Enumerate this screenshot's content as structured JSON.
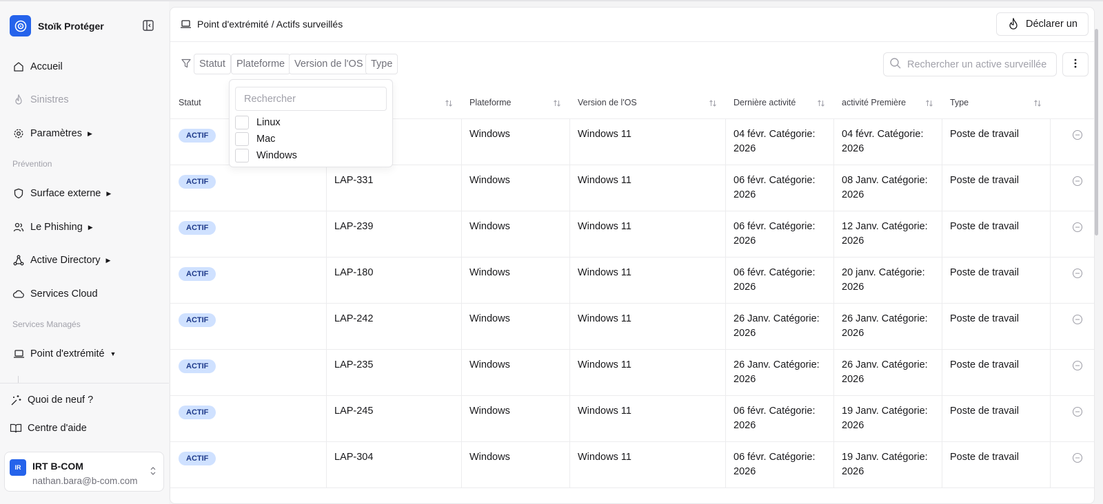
{
  "brand": {
    "name": "Stoïk Protéger"
  },
  "colors": {
    "accent": "#2563eb",
    "badge_bg": "#cfe1ff",
    "badge_text": "#1e3a8a"
  },
  "sidebar": {
    "nav": [
      {
        "label": "Accueil",
        "icon": "home-icon"
      },
      {
        "label": "Sinistres",
        "icon": "flame-icon",
        "disabled": true
      },
      {
        "label": "Paramètres",
        "icon": "gear-icon"
      }
    ],
    "prevention_label": "Prévention",
    "prevention": [
      {
        "label": "Surface externe",
        "icon": "shield-icon"
      },
      {
        "label": "Le Phishing",
        "icon": "users-icon"
      },
      {
        "label": "Active Directory",
        "icon": "network-icon"
      },
      {
        "label": "Services Cloud",
        "icon": "cloud-icon"
      }
    ],
    "managed_label": "Services Managés",
    "managed": [
      {
        "label": "Point d'extrémité",
        "icon": "laptop-icon"
      }
    ],
    "footer": [
      {
        "label": "Quoi de neuf ?",
        "icon": "sparkle-icon"
      },
      {
        "label": "Centre d'aide",
        "icon": "book-icon"
      }
    ],
    "user": {
      "initials": "IR",
      "name": "IRT B-COM",
      "email": "nathan.bara@b-com.com"
    }
  },
  "header": {
    "breadcrumb": "Point d'extrémité / Actifs surveillés",
    "declare_label": "Déclarer un"
  },
  "filters": {
    "chips": [
      "Statut",
      "Plateforme",
      "Version de l'OS",
      "Type"
    ],
    "search_placeholder": "Rechercher un active surveillée"
  },
  "dropdown": {
    "search_placeholder": "Rechercher",
    "options": [
      "Linux",
      "Mac",
      "Windows"
    ]
  },
  "table": {
    "columns": [
      "Statut",
      "",
      "Plateforme",
      "Version de l'OS",
      "Dernière activité",
      "activité Première",
      "Type"
    ],
    "rows": [
      {
        "status": "ACTIF",
        "name": "",
        "platform": "Windows",
        "os": "Windows 11",
        "last_line1": "04 févr. Catégorie:",
        "last_line2": "2026",
        "first_line1": "04 févr. Catégorie:",
        "first_line2": "2026",
        "type": "Poste de travail"
      },
      {
        "status": "ACTIF",
        "name": "LAP-331",
        "platform": "Windows",
        "os": "Windows 11",
        "last_line1": "06 févr. Catégorie:",
        "last_line2": "2026",
        "first_line1": "08 Janv. Catégorie:",
        "first_line2": "2026",
        "type": "Poste de travail"
      },
      {
        "status": "ACTIF",
        "name": "LAP-239",
        "platform": "Windows",
        "os": "Windows 11",
        "last_line1": "06 févr. Catégorie:",
        "last_line2": "2026",
        "first_line1": "12 Janv. Catégorie:",
        "first_line2": "2026",
        "type": "Poste de travail"
      },
      {
        "status": "ACTIF",
        "name": "LAP-180",
        "platform": "Windows",
        "os": "Windows 11",
        "last_line1": "06 févr. Catégorie:",
        "last_line2": "2026",
        "first_line1": "20 janv. Catégorie:",
        "first_line2": "2026",
        "type": "Poste de travail"
      },
      {
        "status": "ACTIF",
        "name": "LAP-242",
        "platform": "Windows",
        "os": "Windows 11",
        "last_line1": "26 Janv. Catégorie:",
        "last_line2": "2026",
        "first_line1": "26 Janv. Catégorie:",
        "first_line2": "2026",
        "type": "Poste de travail"
      },
      {
        "status": "ACTIF",
        "name": "LAP-235",
        "platform": "Windows",
        "os": "Windows 11",
        "last_line1": "26 Janv. Catégorie:",
        "last_line2": "2026",
        "first_line1": "26 Janv. Catégorie:",
        "first_line2": "2026",
        "type": "Poste de travail"
      },
      {
        "status": "ACTIF",
        "name": "LAP-245",
        "platform": "Windows",
        "os": "Windows 11",
        "last_line1": "06 févr. Catégorie:",
        "last_line2": "2026",
        "first_line1": "19 Janv. Catégorie:",
        "first_line2": "2026",
        "type": "Poste de travail"
      },
      {
        "status": "ACTIF",
        "name": "LAP-304",
        "platform": "Windows",
        "os": "Windows 11",
        "last_line1": "06 févr. Catégorie:",
        "last_line2": "2026",
        "first_line1": "19 Janv. Catégorie:",
        "first_line2": "2026",
        "type": "Poste de travail"
      }
    ]
  }
}
